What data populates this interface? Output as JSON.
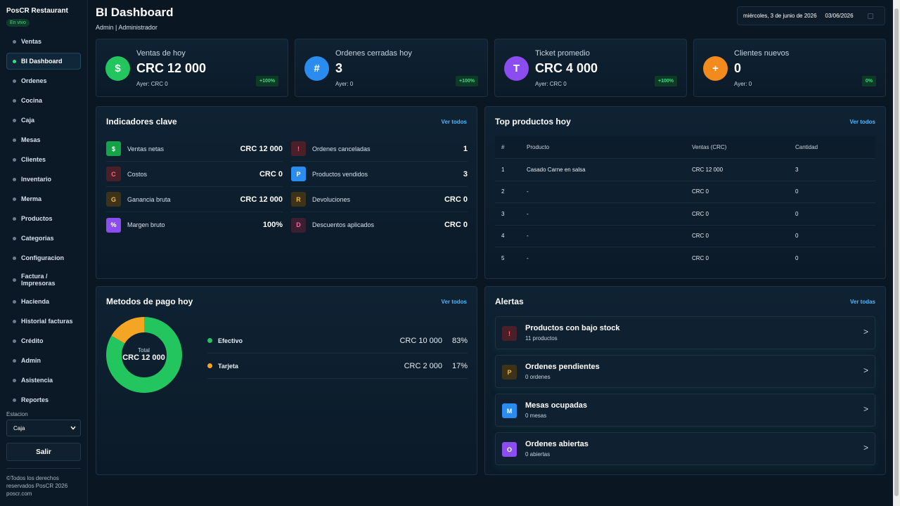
{
  "sidebar": {
    "brand": "PosCR Restaurant",
    "live_badge": "En vivo",
    "items": [
      {
        "label": "Ventas"
      },
      {
        "label": "BI Dashboard",
        "active": true
      },
      {
        "label": "Ordenes"
      },
      {
        "label": "Cocina"
      },
      {
        "label": "Caja"
      },
      {
        "label": "Mesas"
      },
      {
        "label": "Clientes"
      },
      {
        "label": "Inventario"
      },
      {
        "label": "Merma"
      },
      {
        "label": "Productos"
      },
      {
        "label": "Categorias"
      },
      {
        "label": "Configuracion"
      },
      {
        "label": "Factura / Impresoras"
      },
      {
        "label": "Hacienda"
      },
      {
        "label": "Historial facturas"
      },
      {
        "label": "Crédito"
      },
      {
        "label": "Admin"
      },
      {
        "label": "Asistencia"
      },
      {
        "label": "Reportes"
      }
    ],
    "station_label": "Estacion",
    "station_value": "Caja",
    "logout_label": "Salir",
    "footer_line1": "©Todos los derechos",
    "footer_line2": "reservados PosCR 2026",
    "footer_line3": "poscr.com"
  },
  "header": {
    "title": "BI Dashboard",
    "user": "Admin | Administrador",
    "date_text": "miércoles, 3 de junio de 2026",
    "date_input": "03/06/2026"
  },
  "kpis": [
    {
      "label": "Ventas de hoy",
      "value": "CRC 12 000",
      "sub": "Ayer: CRC 0",
      "badge": "+100%",
      "icon": "$",
      "color": "#22c55e"
    },
    {
      "label": "Ordenes cerradas hoy",
      "value": "3",
      "sub": "Ayer: 0",
      "badge": "+100%",
      "icon": "#",
      "color": "#2b8cf0"
    },
    {
      "label": "Ticket promedio",
      "value": "CRC 4 000",
      "sub": "Ayer: CRC 0",
      "badge": "+100%",
      "icon": "T",
      "color": "#8b4cf0"
    },
    {
      "label": "Clientes nuevos",
      "value": "0",
      "sub": "Ayer: 0",
      "badge": "0%",
      "icon": "+",
      "color": "#f38a1e"
    }
  ],
  "indicators": {
    "title": "Indicadores clave",
    "link": "Ver todos",
    "left": [
      {
        "icon": "$",
        "label": "Ventas netas",
        "value": "CRC 12 000"
      },
      {
        "icon": "C",
        "label": "Costos",
        "value": "CRC 0"
      },
      {
        "icon": "G",
        "label": "Ganancia bruta",
        "value": "CRC 12 000"
      },
      {
        "icon": "%",
        "label": "Margen bruto",
        "value": "100%"
      }
    ],
    "right": [
      {
        "icon": "!",
        "label": "Ordenes canceladas",
        "value": "1"
      },
      {
        "icon": "P",
        "label": "Productos vendidos",
        "value": "3"
      },
      {
        "icon": "R",
        "label": "Devoluciones",
        "value": "CRC 0"
      },
      {
        "icon": "D",
        "label": "Descuentos aplicados",
        "value": "CRC 0"
      }
    ]
  },
  "top_products": {
    "title": "Top productos hoy",
    "link": "Ver todos",
    "columns": [
      "#",
      "Producto",
      "Ventas (CRC)",
      "Cantidad"
    ],
    "rows": [
      [
        "1",
        "Casado Carne en salsa",
        "CRC 12 000",
        "3"
      ],
      [
        "2",
        "-",
        "CRC 0",
        "0"
      ],
      [
        "3",
        "-",
        "CRC 0",
        "0"
      ],
      [
        "4",
        "-",
        "CRC 0",
        "0"
      ],
      [
        "5",
        "-",
        "CRC 0",
        "0"
      ]
    ]
  },
  "payments": {
    "title": "Metodos de pago hoy",
    "link": "Ver todos",
    "total_label": "Total",
    "total_value": "CRC 12 000",
    "items": [
      {
        "label": "Efectivo",
        "amount": "CRC 10 000",
        "pct": "83%",
        "fraction": 0.8333,
        "color": "#22c55e"
      },
      {
        "label": "Tarjeta",
        "amount": "CRC 2 000",
        "pct": "17%",
        "fraction": 0.1667,
        "color": "#f5a524"
      }
    ]
  },
  "alerts": {
    "title": "Alertas",
    "link": "Ver todas",
    "items": [
      {
        "icon": "!",
        "title": "Productos con bajo stock",
        "sub": "11 productos"
      },
      {
        "icon": "P",
        "title": "Ordenes pendientes",
        "sub": "0 ordenes"
      },
      {
        "icon": "M",
        "title": "Mesas ocupadas",
        "sub": "0 mesas"
      },
      {
        "icon": "O",
        "title": "Ordenes abiertas",
        "sub": "0 abiertas"
      }
    ],
    "chevron": ">"
  }
}
